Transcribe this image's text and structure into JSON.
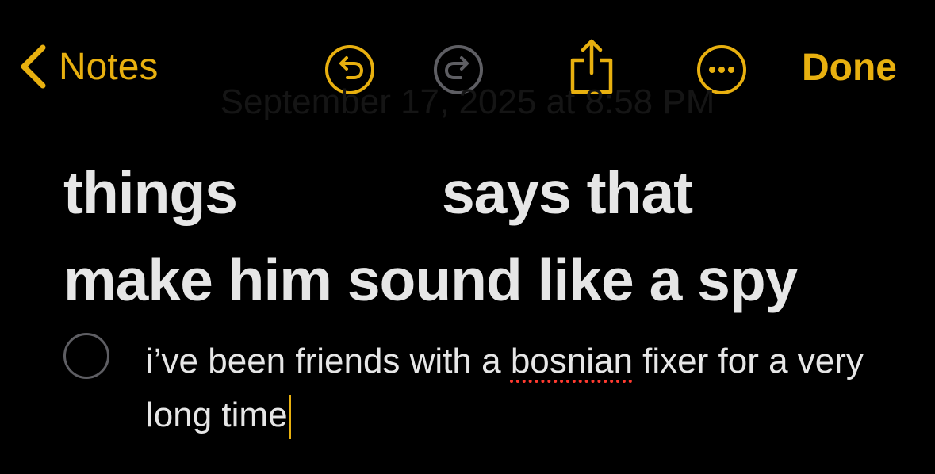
{
  "toolbar": {
    "back_label": "Notes",
    "done_label": "Done",
    "accent_color": "#e8b00f",
    "icons": [
      "chevron-left-icon",
      "undo-icon",
      "redo-icon",
      "share-icon",
      "more-icon"
    ]
  },
  "note": {
    "date": "September 17, 2025 at 8:58 PM",
    "title_line1_part1": "things",
    "title_line1_part2": "says that",
    "title_line2": "make him sound like a spy",
    "checklist": [
      {
        "text_before": "i’ve been friends with a ",
        "misspelled": "bosnian",
        "text_after": " fixer for a very long time",
        "checked": false
      }
    ]
  }
}
